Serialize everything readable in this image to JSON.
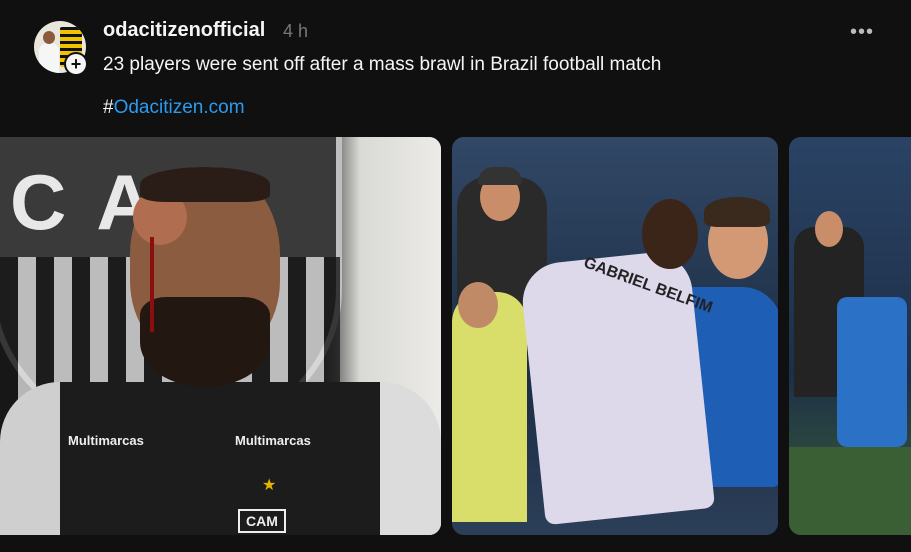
{
  "post": {
    "username": "odacitizenofficial",
    "time": "4 h",
    "more_label": "•••",
    "caption": "23 players were sent off after a mass brawl in Brazil football match",
    "hashtag_prefix": "#",
    "hashtag_link": "Odacitizen.com",
    "follow_symbol": "+"
  },
  "media": [
    {
      "crest_letters": "CAM",
      "sponsor_left": "Multimarcas",
      "sponsor_right": "Multimarcas",
      "crest_badge": "CAM"
    },
    {
      "shirt_name": "GABRIEL BELFIM"
    },
    {}
  ],
  "icons": [
    "more-options-icon",
    "follow-plus-icon"
  ],
  "colors": {
    "background": "#101010",
    "link": "#2b9bf0",
    "muted": "#777777"
  }
}
